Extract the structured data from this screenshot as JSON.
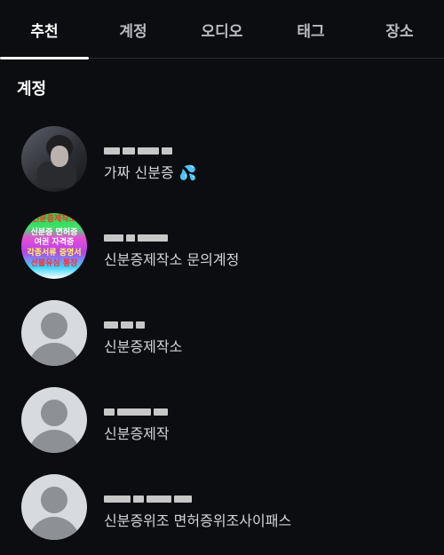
{
  "tabs": [
    {
      "label": "추천",
      "active": true
    },
    {
      "label": "계정",
      "active": false
    },
    {
      "label": "오디오",
      "active": false
    },
    {
      "label": "태그",
      "active": false
    },
    {
      "label": "장소",
      "active": false
    }
  ],
  "section_title": "계정",
  "accounts": [
    {
      "display_name": "가짜 신분증",
      "avatar": "photo",
      "emoji": "💦"
    },
    {
      "display_name": "신분증제작소 문의계정",
      "avatar": "poster",
      "avatar_text": [
        "신분증제작소",
        "신분증 면허증",
        "여권 자격증",
        "각종서류 증명서",
        "선불유심 통장"
      ]
    },
    {
      "display_name": "신분증제작소",
      "avatar": "default"
    },
    {
      "display_name": "신분증제작",
      "avatar": "default"
    },
    {
      "display_name": "신분증위조 면허증위조사이패스",
      "avatar": "default"
    }
  ],
  "colors": {
    "background": "#0b0d10",
    "active_tab": "#ffffff",
    "inactive_tab": "#b9bcc2",
    "default_avatar_bg": "#d7dade"
  }
}
